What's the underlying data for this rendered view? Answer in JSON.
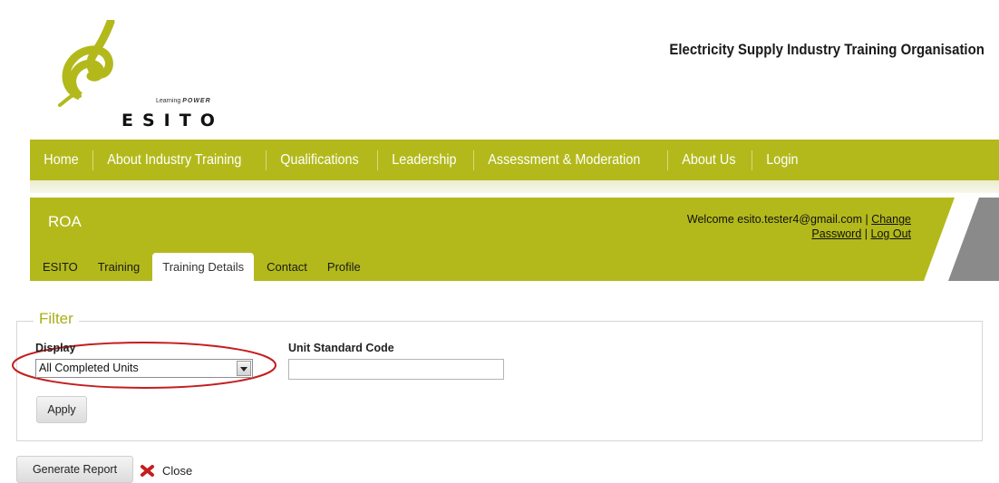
{
  "logo": {
    "word": "ESITO",
    "tagline_prefix": "Learning",
    "tagline_brand": "POWER"
  },
  "org_title": "Electricity Supply Industry Training Organisation",
  "main_nav": {
    "items": [
      "Home",
      "About Industry Training",
      "Qualifications",
      "Leadership",
      "Assessment & Moderation",
      "About Us",
      "Login"
    ]
  },
  "roa": {
    "title": "ROA",
    "welcome_prefix": "Welcome esito.tester4@gmail.com |",
    "change_password_part1": "Change",
    "change_password_part2": "Password",
    "separator": "|",
    "logout": "Log Out"
  },
  "sub_tabs": {
    "items": [
      "ESITO",
      "Training",
      "Training Details",
      "Contact",
      "Profile"
    ],
    "active": "Training Details"
  },
  "filter": {
    "legend": "Filter",
    "display_label": "Display",
    "display_value": "All Completed Units",
    "unit_code_label": "Unit Standard Code",
    "unit_code_value": "",
    "apply_label": "Apply"
  },
  "actions": {
    "generate_report_label": "Generate Report",
    "close_label": "Close"
  },
  "colors": {
    "brand_green": "#b3b91b",
    "accent_red": "#c41e1e",
    "legend_green": "#a9ae17"
  }
}
